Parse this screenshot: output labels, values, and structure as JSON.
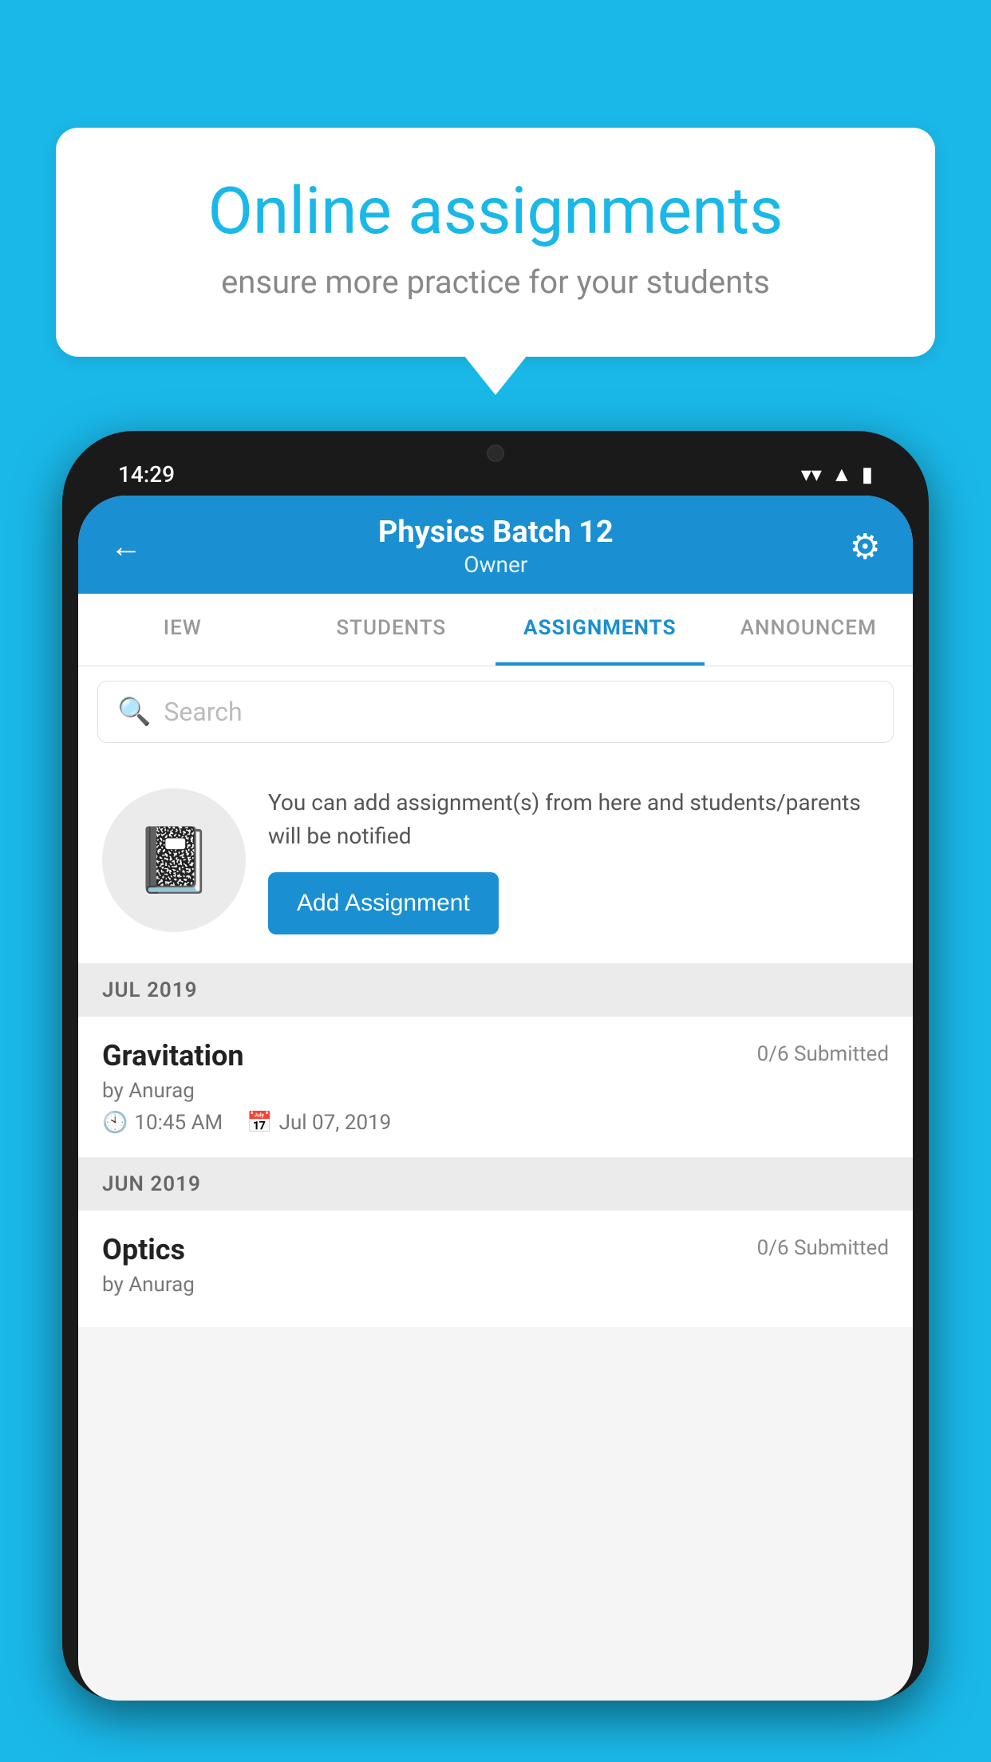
{
  "background_color": "#1ab8e8",
  "speech_bubble": {
    "title": "Online assignments",
    "subtitle": "ensure more practice for your students"
  },
  "phone": {
    "status_bar": {
      "time": "14:29",
      "icons": [
        "wifi",
        "signal",
        "battery"
      ]
    },
    "header": {
      "title": "Physics Batch 12",
      "subtitle": "Owner",
      "back_label": "←",
      "gear_label": "⚙"
    },
    "tabs": [
      {
        "label": "IEW",
        "active": false
      },
      {
        "label": "STUDENTS",
        "active": false
      },
      {
        "label": "ASSIGNMENTS",
        "active": true
      },
      {
        "label": "ANNOUNCEM",
        "active": false
      }
    ],
    "search": {
      "placeholder": "Search"
    },
    "promo": {
      "description": "You can add assignment(s) from here and students/parents will be notified",
      "button_label": "Add Assignment"
    },
    "sections": [
      {
        "month": "JUL 2019",
        "assignments": [
          {
            "name": "Gravitation",
            "submitted": "0/6 Submitted",
            "by": "by Anurag",
            "time": "10:45 AM",
            "date": "Jul 07, 2019"
          }
        ]
      },
      {
        "month": "JUN 2019",
        "assignments": [
          {
            "name": "Optics",
            "submitted": "0/6 Submitted",
            "by": "by Anurag",
            "time": "",
            "date": ""
          }
        ]
      }
    ]
  }
}
